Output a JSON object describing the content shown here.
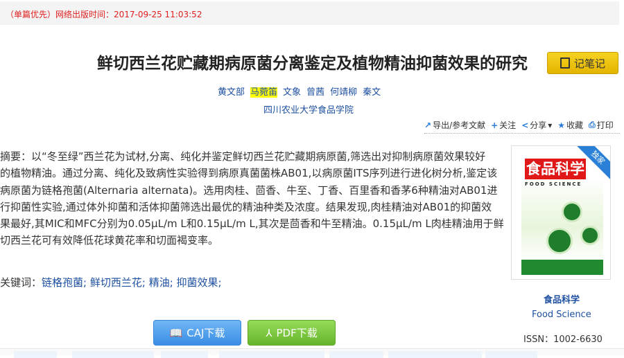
{
  "publish_info": "（单篇优先）网络出版时间：2017-09-25 11:03:52",
  "title": "鲜切西兰花贮藏期病原菌分离鉴定及植物精油抑菌效果的研究",
  "note_button": "记笔记",
  "authors": [
    "黄文部",
    "马菀笛",
    "文象",
    "曾茜",
    "何靖柳",
    "秦文"
  ],
  "organization": "四川农业大学食品学院",
  "tools": {
    "export": "导出/参考文献",
    "follow": "关注",
    "share": "分享",
    "favorite": "收藏",
    "print": "打印"
  },
  "abstract_lines": [
    "摘要：以“冬至绿”西兰花为试材,分离、纯化并鉴定鲜切西兰花贮藏期病原菌,筛选出对抑制病原菌效果较好",
    "的植物精油。通过分离、纯化及致病性实验得到病原真菌菌株AB01,以病原菌ITS序列进行进化树分析,鉴定该",
    "病原菌为链格孢菌(Alternaria alternata)。选用肉桂、茴香、牛至、丁香、百里香和香茅6种精油对AB01进",
    "行抑菌性实验,通过体外抑菌和活体抑菌筛选出最优的精油种类及浓度。结果发现,肉桂精油对AB01的抑菌效",
    "果最好,其MIC和MFC分别为0.05μL/m L和0.15μL/m L,其次是茴香和牛至精油。0.15μL/m L肉桂精油用于鲜",
    "切西兰花可有效降低花球黄花率和切面褐变率。"
  ],
  "keywords_label": "关键词：",
  "keywords": [
    "链格孢菌;",
    "鲜切西兰花;",
    "精油;",
    "抑菌效果;"
  ],
  "journal": {
    "cover_title": "食品科学",
    "cover_en": "FOOD SCIENCE",
    "badge": "独家",
    "name": "食品科学",
    "name_en": "Food Science",
    "issn": "ISSN：1002-6630"
  },
  "download": {
    "caj": "CAJ下载",
    "pdf": "PDF下载"
  }
}
